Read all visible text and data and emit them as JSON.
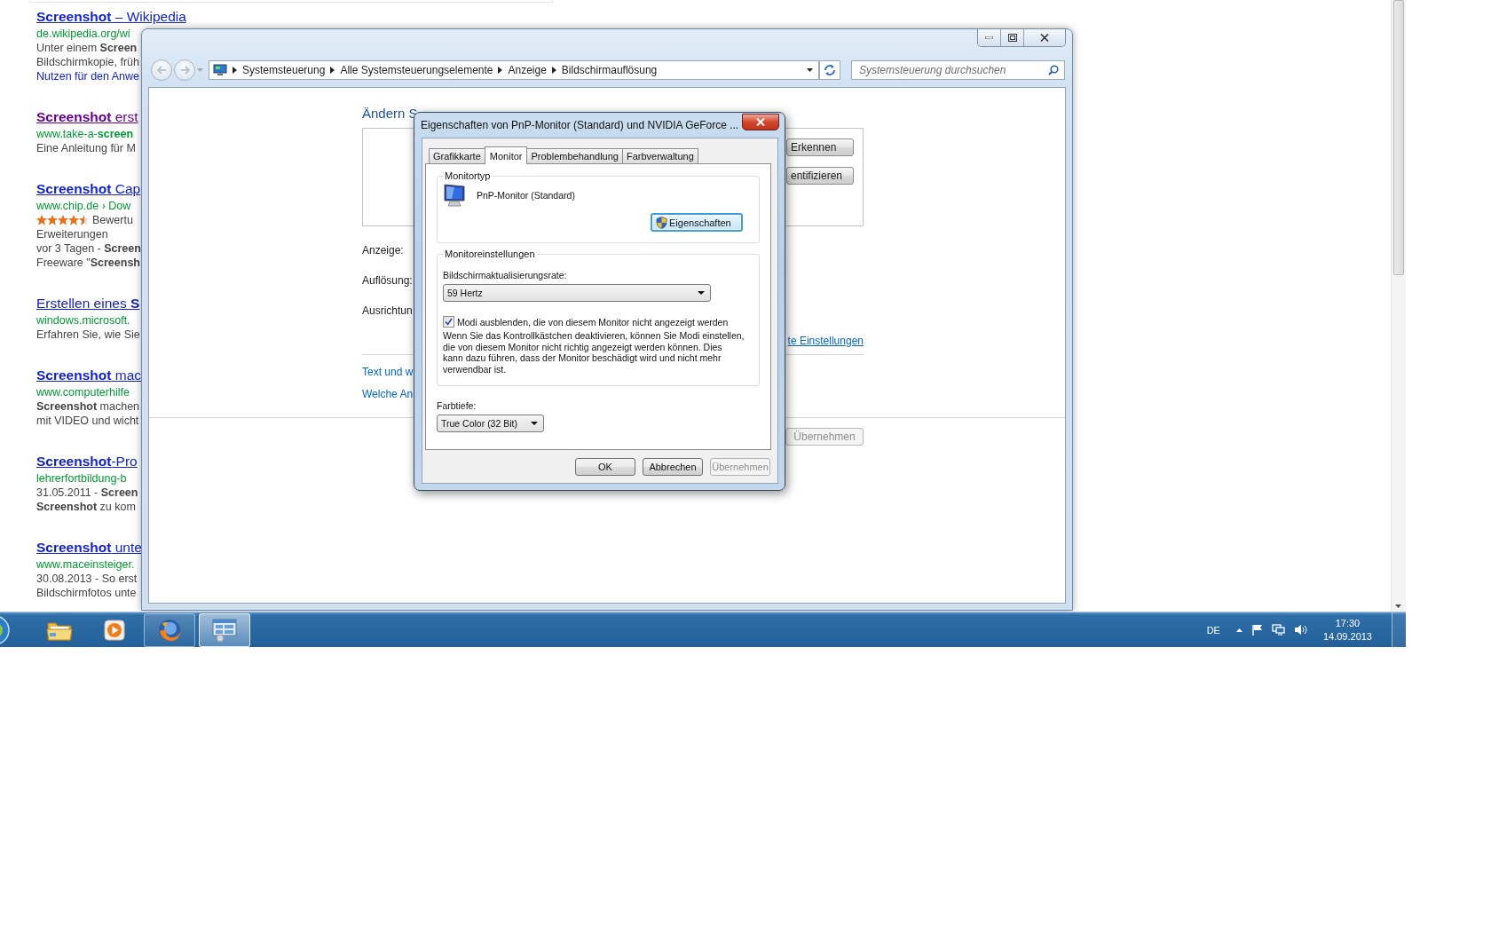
{
  "browser": {
    "results": [
      {
        "title": "**Screenshot** – Wikipedia",
        "visited": false,
        "url": "de.wikipedia.org/wi",
        "snippet": [
          "Unter einem **Screen**",
          "Bildschirmkopie, früh"
        ],
        "link": "Nutzen für den Anwe"
      },
      {
        "title": "**Screenshot** erst",
        "visited": true,
        "url": "www.take-a-**screen**",
        "snippet": [
          "Eine Anleitung für M"
        ]
      },
      {
        "title": "**Screenshot** Cap",
        "visited": false,
        "url": "www.chip.de › Dow",
        "rating": {
          "stars": 4.5,
          "text": "Bewertu"
        },
        "snippet": [
          "Erweiterungen",
          "vor 3 Tagen - **Screen**",
          "Freeware \"**Screensh**"
        ]
      },
      {
        "title": "Erstellen eines **S**",
        "visited": false,
        "url": "windows.microsoft.",
        "snippet": [
          "Erfahren Sie, wie Sie"
        ]
      },
      {
        "title": "**Screenshot** mac",
        "visited": false,
        "url": "www.computerhilfe",
        "snippet": [
          "**Screenshot** machen",
          "mit VIDEO und wicht"
        ]
      },
      {
        "title": "**Screenshot**-Pro",
        "visited": false,
        "url": "lehrerfortbildung-b",
        "snippet": [
          "31.05.2011 - **Screen**",
          "**Screenshot** zu kom"
        ]
      },
      {
        "title": "**Screenshot** unte",
        "visited": false,
        "url": "www.maceinsteiger.",
        "snippet": [
          "30.08.2013 - So erst",
          "Bildschirmfotos unte"
        ]
      }
    ]
  },
  "control_panel": {
    "breadcrumb": [
      "Systemsteuerung",
      "Alle Systemsteuerungselemente",
      "Anzeige",
      "Bildschirmauflösung"
    ],
    "search": {
      "placeholder": "Systemsteuerung durchsuchen"
    },
    "heading": "Ändern S",
    "preview_buttons": [
      "Erkennen",
      "entifizieren"
    ],
    "fields": [
      "Anzeige:",
      "Auflösung:",
      "Ausrichtun"
    ],
    "advanced_link": "te Einstellungen",
    "links": [
      "Text und w",
      "Welche An"
    ],
    "apply_button": {
      "label": "Übernehmen",
      "disabled": true
    }
  },
  "dialog": {
    "title": "Eigenschaften von PnP-Monitor (Standard) und NVIDIA GeForce ...",
    "tabs": [
      {
        "label": "Grafikkarte",
        "selected": false
      },
      {
        "label": "Monitor",
        "selected": true
      },
      {
        "label": "Problembehandlung",
        "selected": false
      },
      {
        "label": "Farbverwaltung",
        "selected": false
      }
    ],
    "monitor_type": {
      "legend": "Monitortyp",
      "name": "PnP-Monitor (Standard)",
      "button": "Eigenschaften"
    },
    "settings": {
      "legend": "Monitoreinstellungen",
      "rate_label": "Bildschirmaktualisierungsrate:",
      "rate": "59 Hertz",
      "hide_modes": {
        "label": "Modi ausblenden, die von diesem Monitor nicht angezeigt werden",
        "checked": true
      },
      "note": "Wenn Sie das Kontrollkästchen deaktivieren, können Sie Modi einstellen, die von diesem Monitor nicht richtig angezeigt werden können. Dies kann dazu führen, dass der Monitor beschädigt wird und nicht mehr verwendbar ist."
    },
    "color_depth": {
      "label": "Farbtiefe:",
      "value": "True Color (32 Bit)"
    },
    "buttons": [
      {
        "label": "OK",
        "disabled": false
      },
      {
        "label": "Abbrechen",
        "disabled": false
      },
      {
        "label": "Übernehmen",
        "disabled": true
      }
    ]
  },
  "taskbar": {
    "apps": [
      {
        "kind": "folder",
        "running": false,
        "selected": false
      },
      {
        "kind": "media",
        "running": false,
        "selected": false
      },
      {
        "kind": "browser",
        "running": true,
        "selected": false
      },
      {
        "kind": "control-panel",
        "running": true,
        "selected": true
      }
    ],
    "language": "DE",
    "time": "17:30",
    "date": "14.09.2013"
  }
}
